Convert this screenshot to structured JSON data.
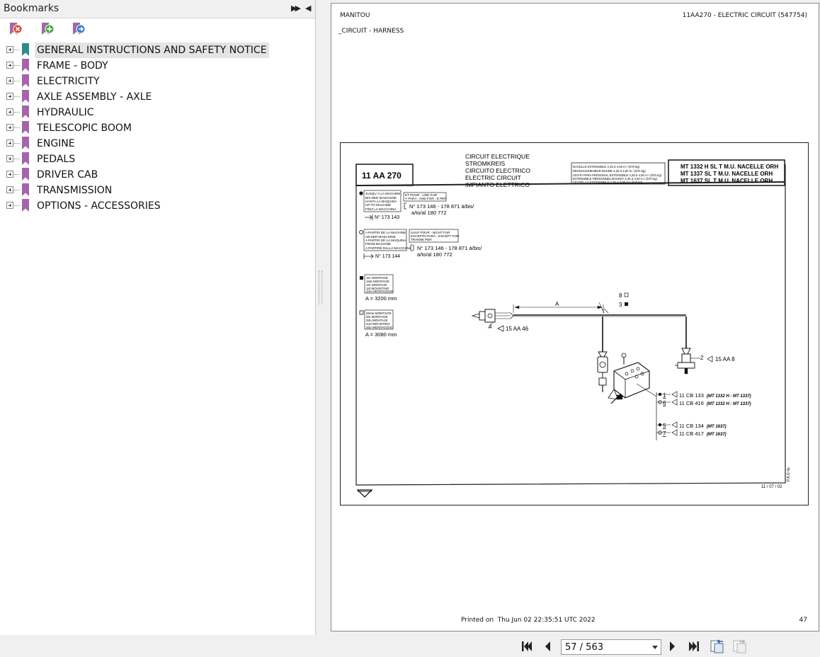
{
  "bookmarks_panel": {
    "title": "Bookmarks",
    "expand_all_icon": "double-triangle-right-icon",
    "collapse_icon": "triangle-left-icon",
    "toolbar": [
      {
        "name": "delete-bookmark-icon"
      },
      {
        "name": "add-bookmark-icon"
      },
      {
        "name": "add-child-bookmark-icon"
      }
    ],
    "items": [
      {
        "label": "GENERAL INSTRUCTIONS AND SAFETY NOTICE",
        "selected": true,
        "icon_color": "#2e8b8b"
      },
      {
        "label": "FRAME - BODY",
        "icon_color": "#a466a8"
      },
      {
        "label": "ELECTRICITY",
        "icon_color": "#a466a8"
      },
      {
        "label": "AXLE ASSEMBLY - AXLE",
        "icon_color": "#a466a8"
      },
      {
        "label": "HYDRAULIC",
        "icon_color": "#a466a8"
      },
      {
        "label": "TELESCOPIC BOOM",
        "icon_color": "#a466a8"
      },
      {
        "label": "ENGINE",
        "icon_color": "#a466a8"
      },
      {
        "label": "PEDALS",
        "icon_color": "#a466a8"
      },
      {
        "label": "DRIVER CAB",
        "icon_color": "#a466a8"
      },
      {
        "label": "TRANSMISSION",
        "icon_color": "#a466a8"
      },
      {
        "label": "OPTIONS - ACCESSORIES",
        "icon_color": "#a466a8"
      }
    ]
  },
  "page": {
    "header_left": "MANITOU",
    "header_right": "11AA270 - ELECTRIC CIRCUIT (547754)",
    "subheader": "_CIRCUIT - HARNESS",
    "footer_printed": "Printed on  Thu Jun 02 22:35:51 UTC 2022",
    "footer_page_number": "47",
    "drawing": {
      "code": "11 AA 270",
      "titles": [
        "CIRCUIT ELECTRIQUE",
        "STROMKREIS",
        "CIRCUITO ELECTRICO",
        "ELECTRIC CIRCUIT",
        "IMPIANTO ELETTRICO"
      ],
      "platform_lines": [
        "NACELLE EXTENSIBLE 2,25 à 4,00 m / (570 kg)",
        "DEHNAUSZIEHBAR BUHNE 2,25 à 4,00 m / (570 kg)",
        "CESTA PARA PERSONAL EXTENSIBLE 2,25 à 4,00 m / (570 kg)",
        "EXTENSIBLE PERSONNEL BASKET 2,25 à 4,00 m / (570 kg)",
        "CESTELLO ESTENSIBILE 2,25 à 4,00 m / (570 kg)"
      ],
      "models": [
        "MT 1332 H SL T M.U. NACELLE ORH",
        "MT 1337 SL T M.U. NACELLE ORH",
        "MT 1637 SL T M.U. NACELLE ORH"
      ],
      "until_box": [
        "JUSQU' A LA MACHINE",
        "BIS DER MASCHINE",
        "HASTA LA MAQUINA",
        "UP TO MACHINE",
        "FINO LA MACCHINA"
      ],
      "until_number": "N° 173 143",
      "and_for_box": [
        "ET POUR - UND FUR",
        "Y PARA - AND FOR - E PER"
      ],
      "and_for_numbers": [
        "N° 173 146 - 178 871 à/bis/",
        "a/to/al 180 772"
      ],
      "from_box": [
        "A PARTIR DE LA MACHINE",
        "AB DER MASCHINE",
        "A PARTIR DE LA MAQUINA",
        "FROM MACHINE",
        "A PARTIRE DALLA MACCHINA"
      ],
      "from_number": "N° 173 144",
      "except_box": [
        "SAUF POUR - NICHT FUR",
        "EXCEPTO PARA - EXCEPT FOR",
        "TRANNE PER"
      ],
      "except_numbers": [
        "N° 173 146 - 178 871 à/bis/",
        "a/to/al 180 772"
      ],
      "mount1_box": [
        "1er MONTAGE",
        "1ste MONTAGE",
        "1er MONTAJE",
        "1st MOUNTING",
        "1mo MONTAGGIO"
      ],
      "mount1_value": "A = 3200 mm",
      "mount2_box": [
        "2ème MONTAGE",
        "2te MONTAGE",
        "2do MONTAJE",
        "2nd MOUNTING",
        "2do MONTAGGIO"
      ],
      "mount2_value": "A = 3080 mm",
      "dim_label": "A",
      "callouts": {
        "c8": "8",
        "c3": "3",
        "c4": "4",
        "ref4": "15 AA 46",
        "c2": "2",
        "ref2": "15 AA 8"
      },
      "refs": [
        {
          "num": "1",
          "ref": "11 CB 133",
          "model": "(MT 1332 H - MT 1337)"
        },
        {
          "num": "6",
          "ref": "11 CB 416",
          "model": "(MT 1332 H - MT 1337)"
        },
        {
          "num": "5",
          "ref": "11 CB 134",
          "model": "(MT 1637)"
        },
        {
          "num": "7",
          "ref": "11 CB 417",
          "model": "(MT 1637)"
        }
      ],
      "date": "11 / 07 / 02",
      "side_code": "P.A.O.4p"
    }
  },
  "navigation": {
    "page_indicator": "57 / 563",
    "icons": [
      "first-page-icon",
      "previous-page-icon",
      "next-page-icon",
      "last-page-icon",
      "go-back-view-icon",
      "go-forward-view-icon"
    ]
  }
}
